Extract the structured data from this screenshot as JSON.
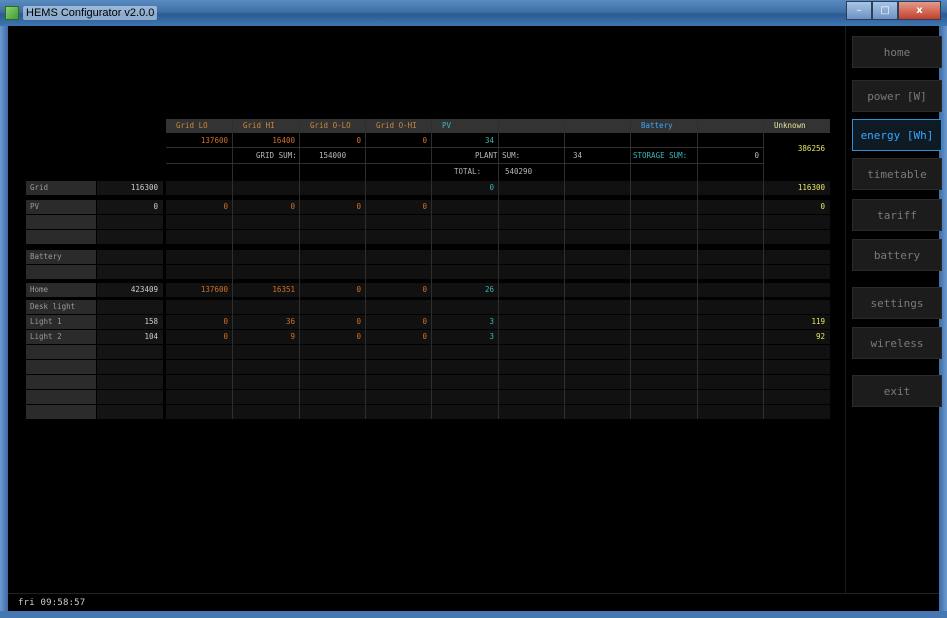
{
  "window": {
    "title": "HEMS Configurator v2.0.0",
    "min_label": "–",
    "max_label": "□",
    "close_label": "x"
  },
  "nav": [
    {
      "label": "home",
      "active": false
    },
    {
      "label": "power [W]",
      "active": false
    },
    {
      "label": "energy [Wh]",
      "active": true
    },
    {
      "label": "timetable",
      "active": false
    },
    {
      "label": "tariff",
      "active": false
    },
    {
      "label": "battery",
      "active": false
    },
    {
      "label": "settings",
      "active": false
    },
    {
      "label": "wireless",
      "active": false
    },
    {
      "label": "exit",
      "active": false
    }
  ],
  "status": {
    "time": "fri 09:58:57"
  },
  "header": {
    "columns": [
      "Grid LO",
      "Grid HI",
      "Grid O-LO",
      "Grid O-HI",
      "PV",
      "",
      "",
      "Battery",
      "",
      "Unknown"
    ],
    "source_values": [
      "137600",
      "16400",
      "0",
      "0",
      "34",
      "",
      "",
      "",
      ""
    ],
    "unknown_value": "386256",
    "grid_sum_label": "GRID SUM:",
    "grid_sum": "154000",
    "plant_sum_label": "PLANT SUM:",
    "plant_sum": "34",
    "storage_sum_label": "STORAGE SUM:",
    "storage_sum": "0",
    "total_label": "TOTAL:",
    "total": "540290"
  },
  "rows": {
    "grid": {
      "label": "Grid",
      "value": "116300",
      "pv": "0",
      "unknown": "116300"
    },
    "pv": {
      "label": "PV",
      "value": "0",
      "cells": [
        "0",
        "0",
        "0",
        "0"
      ],
      "unknown": "0"
    },
    "battery": {
      "label": "Battery"
    },
    "home": {
      "label": "Home",
      "value": "423409",
      "cells": [
        "137600",
        "16351",
        "0",
        "0",
        "26"
      ]
    },
    "loads": [
      {
        "label": "Desk light",
        "value": "",
        "cells": [
          "",
          "",
          "",
          "",
          ""
        ],
        "unknown": ""
      },
      {
        "label": "Light 1",
        "value": "158",
        "cells": [
          "0",
          "36",
          "0",
          "0",
          "3"
        ],
        "unknown": "119"
      },
      {
        "label": "Light 2",
        "value": "104",
        "cells": [
          "0",
          "9",
          "0",
          "0",
          "3"
        ],
        "unknown": "92"
      }
    ]
  },
  "colors": {
    "accent": "#35a8ff",
    "orange": "#d2712a",
    "cyan": "#3ab5b5",
    "yellow": "#e8e864"
  }
}
